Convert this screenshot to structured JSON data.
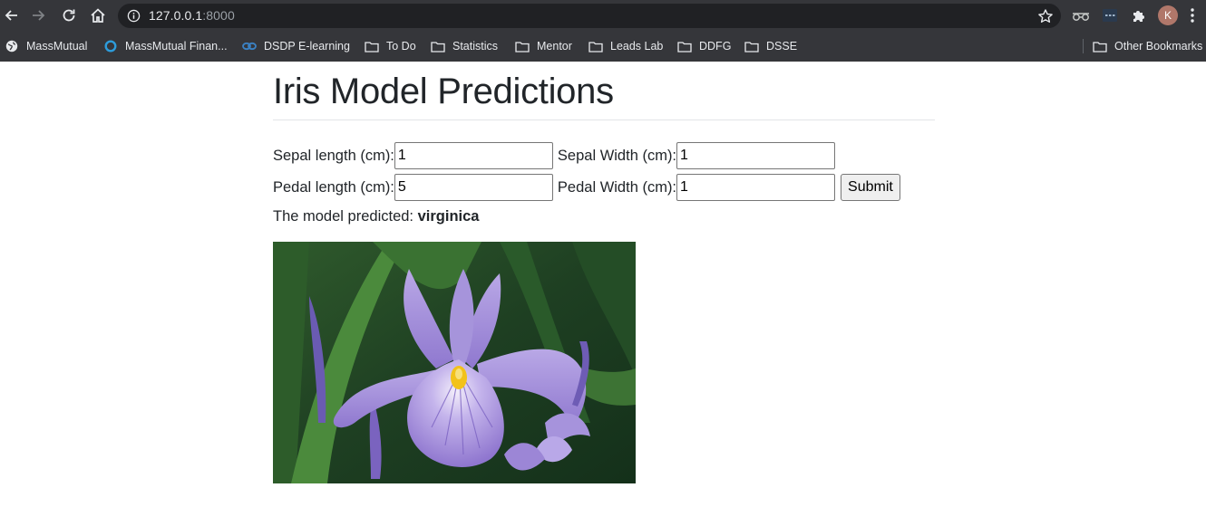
{
  "browser": {
    "url_host": "127.0.0.1",
    "url_port": ":8000",
    "profile_initial": "K",
    "bookmarks": [
      {
        "label": "MassMutual",
        "icon": "globe-icon"
      },
      {
        "label": "MassMutual Finan...",
        "icon": "circle-logo-icon"
      },
      {
        "label": "DSDP E-learning",
        "icon": "link-logo-icon"
      },
      {
        "label": "To Do",
        "icon": "folder-icon"
      },
      {
        "label": "Statistics",
        "icon": "folder-icon"
      },
      {
        "label": "Mentor",
        "icon": "folder-icon"
      },
      {
        "label": "Leads Lab",
        "icon": "folder-icon"
      },
      {
        "label": "DDFG",
        "icon": "folder-icon"
      },
      {
        "label": "DSSE",
        "icon": "folder-icon"
      },
      {
        "label": "Other Bookmarks",
        "icon": "folder-icon"
      }
    ]
  },
  "page": {
    "title": "Iris Model Predictions",
    "form": {
      "sepal_length_label": "Sepal length (cm):",
      "sepal_length_value": "1",
      "sepal_width_label": "Sepal Width (cm):",
      "sepal_width_value": "1",
      "pedal_length_label": "Pedal length (cm):",
      "pedal_length_value": "5",
      "pedal_width_label": "Pedal Width (cm):",
      "pedal_width_value": "1",
      "submit_label": "Submit"
    },
    "prediction_prefix": "The model predicted: ",
    "prediction_value": "virginica"
  },
  "colors": {
    "chrome_bg": "#35363a",
    "omnibox_bg": "#202124",
    "heading_text": "#212529"
  }
}
